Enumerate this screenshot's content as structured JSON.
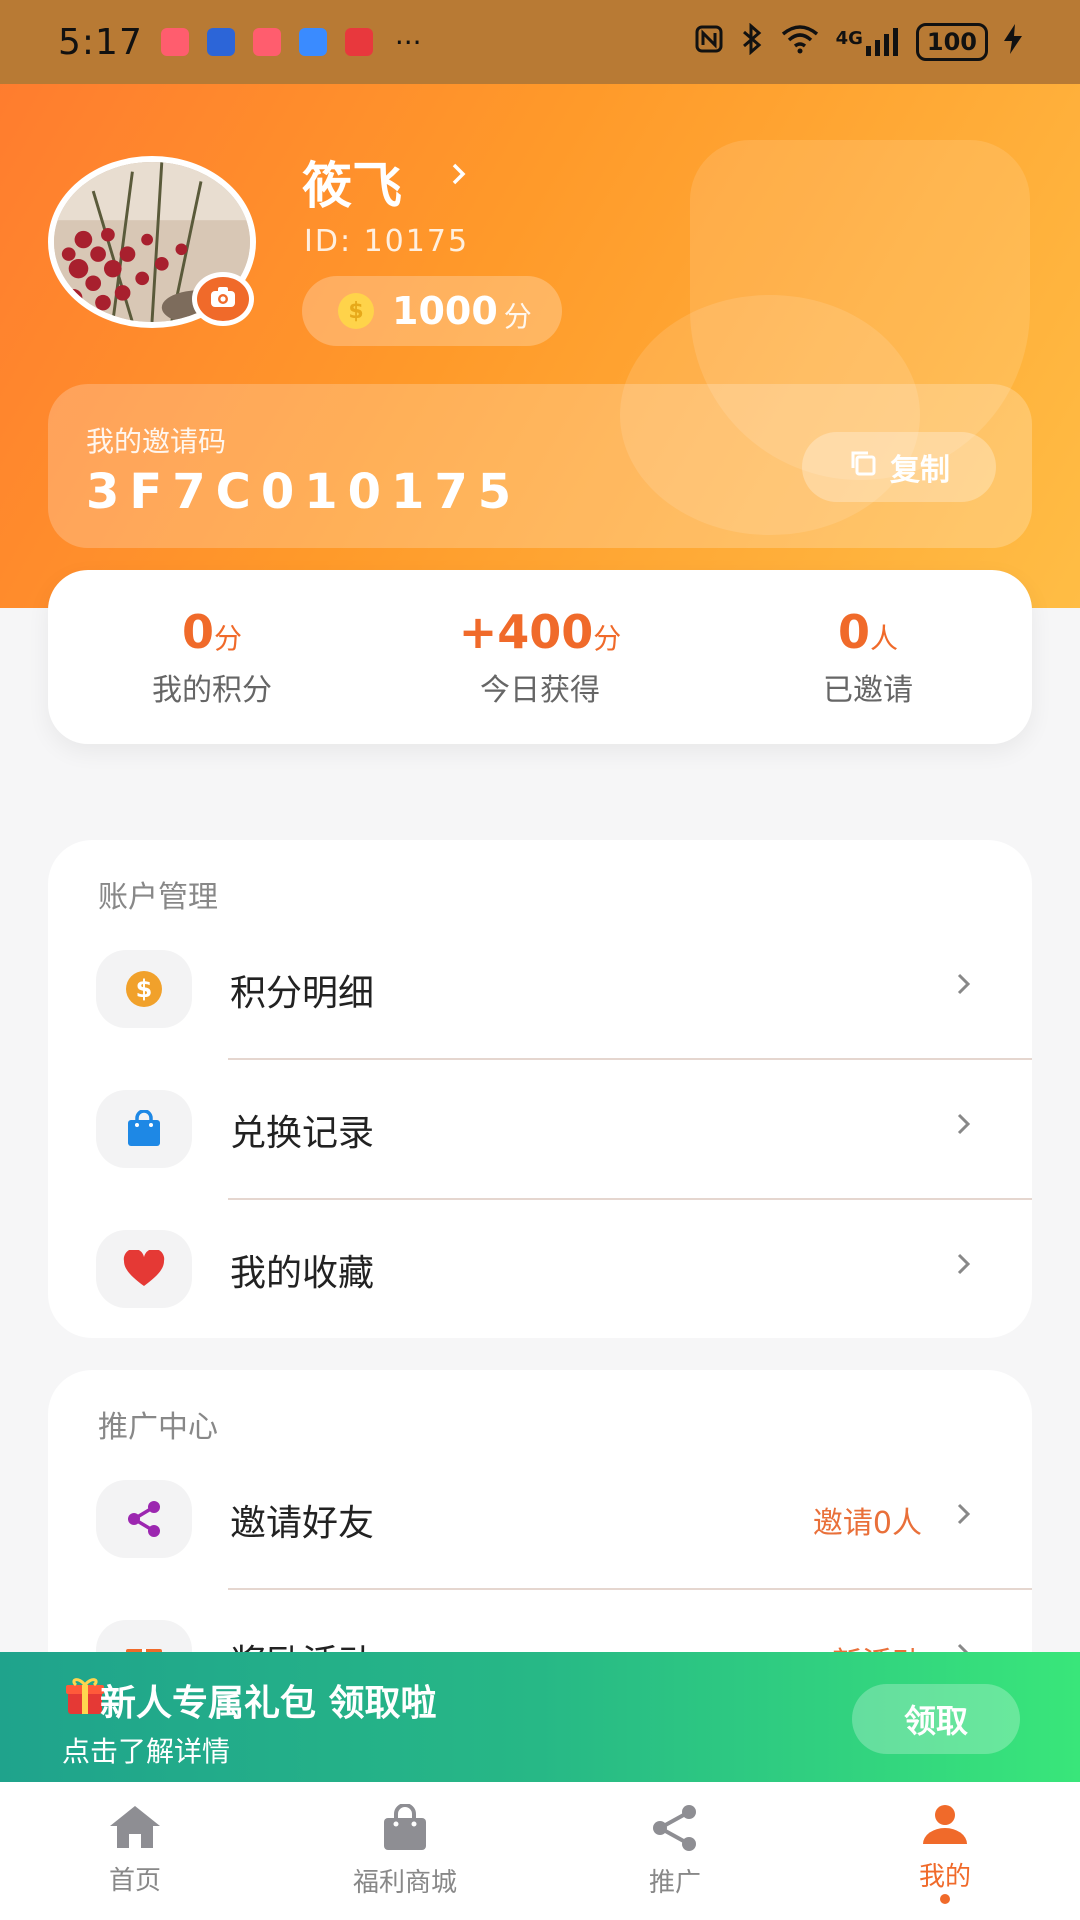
{
  "status_bar": {
    "time": "5:17",
    "battery": "100",
    "network": "4G"
  },
  "profile": {
    "name": "筱飞",
    "id_text": "ID: 10175",
    "points_value": "1000",
    "points_unit": "分"
  },
  "invite": {
    "label": "我的邀请码",
    "code": "3F7C010175",
    "copy_label": "复制"
  },
  "stats": [
    {
      "num": "0",
      "unit": "分",
      "label": "我的积分"
    },
    {
      "num": "+400",
      "unit": "分",
      "label": "今日获得"
    },
    {
      "num": "0",
      "unit": "人",
      "label": "已邀请"
    }
  ],
  "account": {
    "title": "账户管理",
    "items": [
      {
        "label": "积分明细",
        "icon": "coin-icon"
      },
      {
        "label": "兑换记录",
        "icon": "bag-icon"
      },
      {
        "label": "我的收藏",
        "icon": "heart-icon"
      }
    ]
  },
  "promotion": {
    "title": "推广中心",
    "items": [
      {
        "label": "邀请好友",
        "extra": "邀请0人",
        "icon": "share-icon"
      },
      {
        "label": "奖励活动",
        "extra": "新活动",
        "icon": "gift-icon"
      }
    ]
  },
  "promo_banner": {
    "title": "新人专属礼包 领取啦",
    "subtitle": "点击了解详情",
    "button": "领取"
  },
  "bottom_nav": [
    {
      "label": "首页",
      "icon": "home-icon"
    },
    {
      "label": "福利商城",
      "icon": "shop-icon"
    },
    {
      "label": "推广",
      "icon": "share-icon"
    },
    {
      "label": "我的",
      "icon": "user-icon",
      "active": true
    }
  ],
  "colors": {
    "accent": "#f06a2a",
    "hero_start": "#ff7a2f",
    "hero_end": "#ffbd45",
    "promo_start": "#1fa38c",
    "promo_end": "#39e67a"
  }
}
